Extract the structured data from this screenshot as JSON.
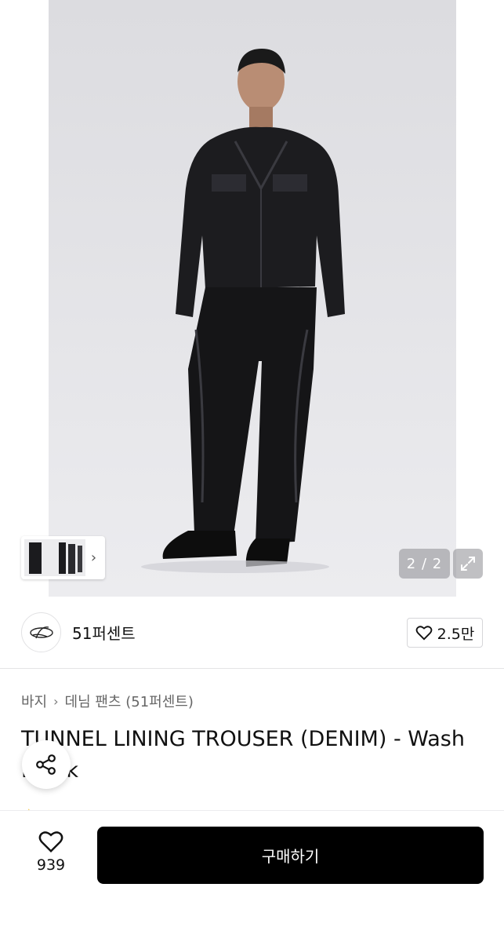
{
  "gallery": {
    "pager_text": "2 / 2"
  },
  "brand": {
    "name": "51퍼센트",
    "like_count": "2.5만"
  },
  "product": {
    "breadcrumb": [
      "바지",
      "데님 팬츠 (51퍼센트)"
    ],
    "title": "TUNNEL LINING TROUSER (DENIM) - Wash Black"
  },
  "bottom_bar": {
    "wish_count": "939",
    "buy_label": "구매하기"
  },
  "icons": {
    "expand": "expand-icon",
    "heart": "heart-icon",
    "share": "share-icon",
    "chevron": "chevron-right-icon"
  },
  "colors": {
    "buy_button": "#000000",
    "rating_star": "#f5b400"
  }
}
